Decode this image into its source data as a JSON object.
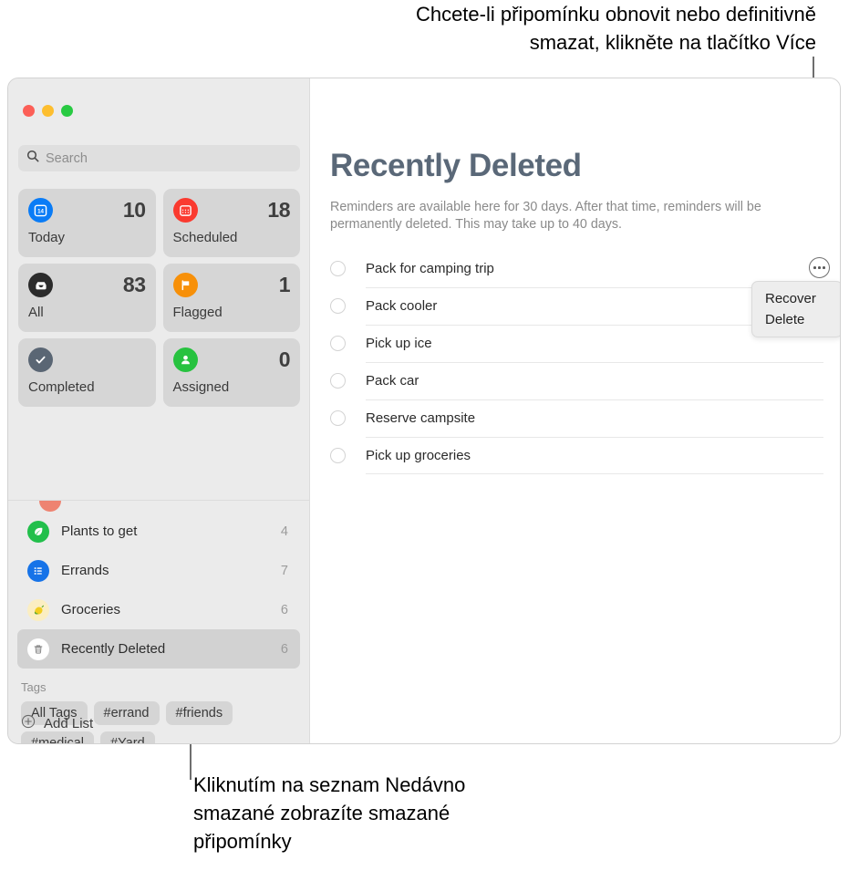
{
  "callouts": {
    "top": "Chcete-li připomínku obnovit nebo definitivně\nsmazat, klikněte na tlačítko Více",
    "bottom": "Kliknutím na seznam Nedávno\nsmazané zobrazíte smazané\npřipomínky"
  },
  "window": {
    "traffic_lights": [
      "close",
      "minimize",
      "zoom"
    ]
  },
  "sidebar": {
    "search": {
      "placeholder": "Search",
      "value": "",
      "icon": "search-icon"
    },
    "tiles": [
      {
        "label": "Today",
        "count": "10",
        "icon": "calendar-today-icon",
        "color": "#0a7cf6"
      },
      {
        "label": "Scheduled",
        "count": "18",
        "icon": "calendar-icon",
        "color": "#fa3a2f"
      },
      {
        "label": "All",
        "count": "83",
        "icon": "inbox-icon",
        "color": "#2b2b2b"
      },
      {
        "label": "Flagged",
        "count": "1",
        "icon": "flag-icon",
        "color": "#f79009"
      },
      {
        "label": "Completed",
        "count": "",
        "icon": "checkmark-icon",
        "color": "#5a6674"
      },
      {
        "label": "Assigned",
        "count": "0",
        "icon": "person-icon",
        "color": "#27c23f"
      }
    ],
    "lists": [
      {
        "name": "Plants to get",
        "count": "4",
        "icon": "leaf-icon",
        "color": "#22bf4b",
        "selected": false
      },
      {
        "name": "Errands",
        "count": "7",
        "icon": "list-bullet-icon",
        "color": "#1673e8",
        "selected": false
      },
      {
        "name": "Groceries",
        "count": "6",
        "icon": "lemon-icon",
        "color": "#fbeec2",
        "selected": false
      },
      {
        "name": "Recently Deleted",
        "count": "6",
        "icon": "trash-icon",
        "color": "#ffffff",
        "selected": true
      }
    ],
    "tags": {
      "title": "Tags",
      "items": [
        "All Tags",
        "#errand",
        "#friends",
        "#medical",
        "#Yard"
      ]
    },
    "add_list": {
      "label": "Add List",
      "icon": "plus-circle-icon"
    }
  },
  "main": {
    "title": "Recently Deleted",
    "description": "Reminders are available here for 30 days. After that time, reminders will be permanently deleted. This may take up to 40 days.",
    "reminders": [
      "Pack for camping trip",
      "Pack cooler",
      "Pick up ice",
      "Pack car",
      "Reserve campsite",
      "Pick up groceries"
    ],
    "more_button": {
      "icon": "ellipsis-circle-icon"
    },
    "popup_menu": {
      "items": [
        "Recover",
        "Delete"
      ]
    }
  }
}
